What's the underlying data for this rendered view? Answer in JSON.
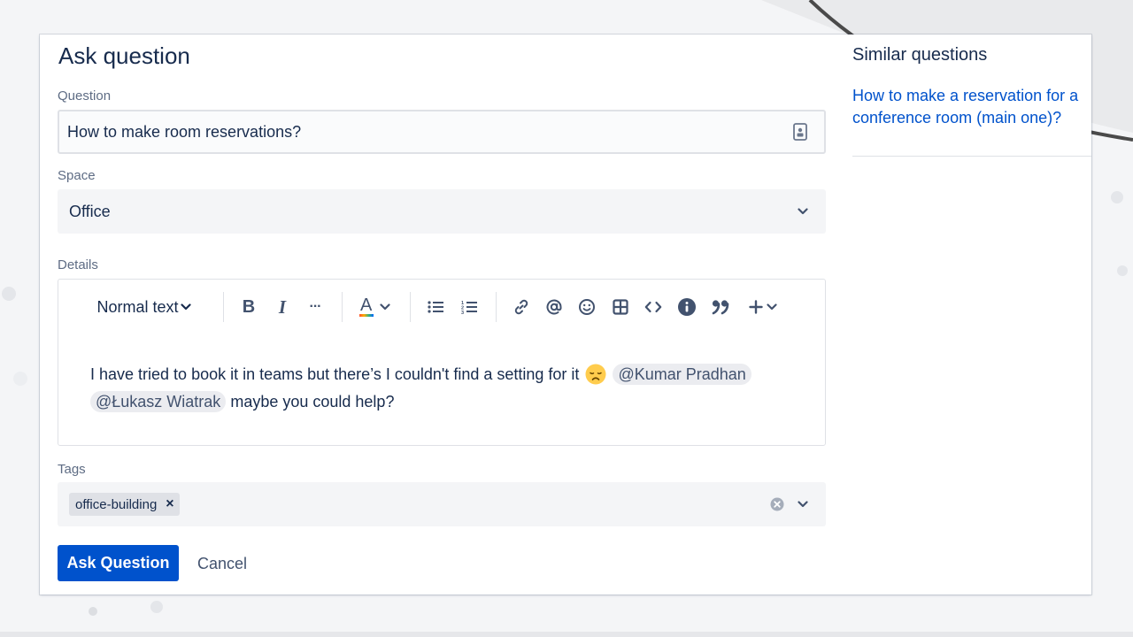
{
  "form": {
    "title": "Ask question",
    "question_label": "Question",
    "question_value": "How to make room reservations?",
    "space_label": "Space",
    "space_value": "Office",
    "details_label": "Details",
    "tags_label": "Tags"
  },
  "toolbar": {
    "text_style": "Normal text",
    "bold": "B",
    "italic": "I",
    "more": "···",
    "text_color": "A",
    "icons": [
      "bold-icon",
      "italic-icon",
      "more-formatting-icon",
      "text-color-icon",
      "bullet-list-icon",
      "numbered-list-icon",
      "link-icon",
      "mention-icon",
      "emoji-icon",
      "table-icon",
      "code-icon",
      "info-panel-icon",
      "quote-icon",
      "insert-plus-icon"
    ]
  },
  "details": {
    "text_before": "I have tried to book it in teams but there’s I couldn't find a setting for it",
    "mention_1": "@Kumar Pradhan",
    "mention_2": "@Łukasz Wiatrak",
    "text_after": "maybe you could help?",
    "emoji": "disappointed-face"
  },
  "tags": {
    "items": [
      "office-building"
    ],
    "remove_symbol": "×"
  },
  "actions": {
    "submit_label": "Ask Question",
    "cancel_label": "Cancel"
  },
  "sidebar": {
    "title": "Similar questions",
    "links": [
      "How to make a reservation for a conference room (main one)?"
    ]
  },
  "colors": {
    "primary": "#0052cc",
    "text": "#172b4d",
    "subtle_text": "#5e6c84",
    "field_bg": "#f4f5f7",
    "border": "#dfe1e6"
  }
}
